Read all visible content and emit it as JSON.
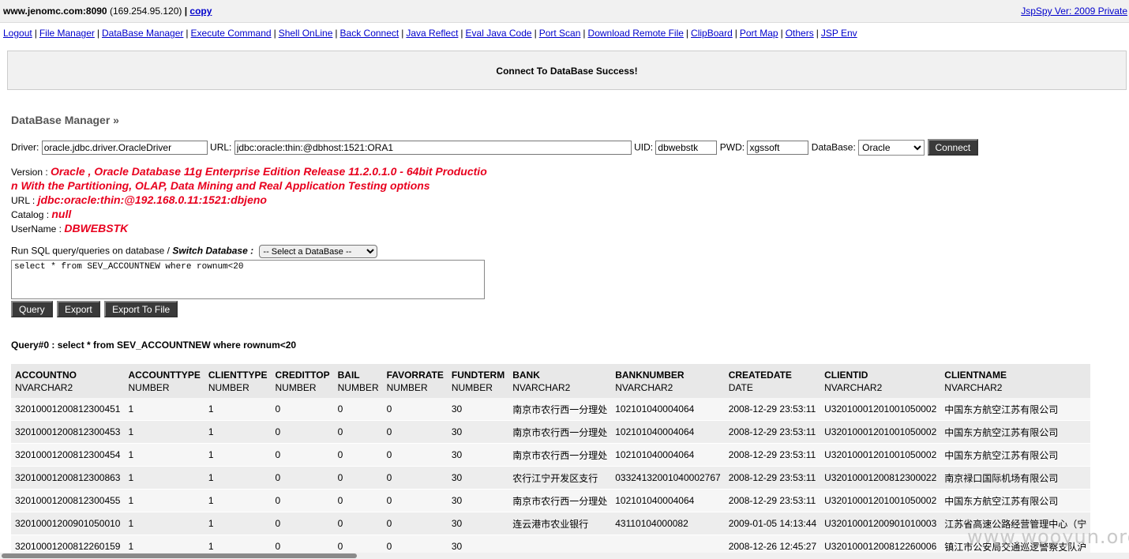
{
  "header": {
    "host": "www.jenomc.com:8090",
    "ip": "(169.254.95.120)",
    "sep": "|",
    "copy_label": "copy",
    "version_label": "JspSpy Ver: 2009 Private"
  },
  "nav": {
    "items": [
      "Logout",
      "File Manager",
      "DataBase Manager",
      "Execute Command",
      "Shell OnLine",
      "Back Connect",
      "Java Reflect",
      "Eval Java Code",
      "Port Scan",
      "Download Remote File",
      "ClipBoard",
      "Port Map",
      "Others",
      "JSP Env"
    ]
  },
  "message": "Connect To DataBase Success!",
  "db_manager_title": "DataBase Manager »",
  "connection": {
    "driver_label": "Driver:",
    "driver_value": "oracle.jdbc.driver.OracleDriver",
    "url_label": "URL:",
    "url_value": "jdbc:oracle:thin:@dbhost:1521:ORA1",
    "uid_label": "UID:",
    "uid_value": "dbwebstk",
    "pwd_label": "PWD:",
    "pwd_value": "xgssoft",
    "database_label": "DataBase:",
    "database_value": "Oracle",
    "connect_label": "Connect"
  },
  "info": {
    "version_label": "Version :",
    "version_value_1": "Oracle , Oracle Database 11g Enterprise Edition Release 11.2.0.1.0 - 64bit Productio",
    "version_value_2": "n With the Partitioning, OLAP, Data Mining and Real Application Testing options",
    "url_label": "URL :",
    "url_value": "jdbc:oracle:thin:@192.168.0.11:1521:dbjeno",
    "catalog_label": "Catalog :",
    "catalog_value": "null",
    "username_label": "UserName :",
    "username_value": "DBWEBSTK"
  },
  "sql": {
    "run_label": "Run SQL query/queries on database /",
    "switch_label": "Switch Database :",
    "switch_select_value": "-- Select a DataBase --",
    "query_text": "select * from SEV_ACCOUNTNEW where rownum<20",
    "query_button": "Query",
    "export_button": "Export",
    "export_file_button": "Export To File"
  },
  "result": {
    "title": "Query#0 : select * from SEV_ACCOUNTNEW where rownum<20",
    "columns": [
      {
        "name": "ACCOUNTNO",
        "type": "NVARCHAR2"
      },
      {
        "name": "ACCOUNTTYPE",
        "type": "NUMBER"
      },
      {
        "name": "CLIENTTYPE",
        "type": "NUMBER"
      },
      {
        "name": "CREDITTOP",
        "type": "NUMBER"
      },
      {
        "name": "BAIL",
        "type": "NUMBER"
      },
      {
        "name": "FAVORRATE",
        "type": "NUMBER"
      },
      {
        "name": "FUNDTERM",
        "type": "NUMBER"
      },
      {
        "name": "BANK",
        "type": "NVARCHAR2"
      },
      {
        "name": "BANKNUMBER",
        "type": "NVARCHAR2"
      },
      {
        "name": "CREATEDATE",
        "type": "DATE"
      },
      {
        "name": "CLIENTID",
        "type": "NVARCHAR2"
      },
      {
        "name": "CLIENTNAME",
        "type": "NVARCHAR2"
      }
    ],
    "rows": [
      [
        "3201000120081230045​1",
        "1",
        "1",
        "0",
        "0",
        "0",
        "30",
        "南京市农行西一分理处",
        "102101040004064",
        "2008-12-29 23:53:11",
        "U32010001201001050002",
        "中国东方航空江苏有限公司"
      ],
      [
        "32010001200812300453",
        "1",
        "1",
        "0",
        "0",
        "0",
        "30",
        "南京市农行西一分理处",
        "102101040004064",
        "2008-12-29 23:53:11",
        "U32010001201001050002",
        "中国东方航空江苏有限公司"
      ],
      [
        "32010001200812300454",
        "1",
        "1",
        "0",
        "0",
        "0",
        "30",
        "南京市农行西一分理处",
        "102101040004064",
        "2008-12-29 23:53:11",
        "U32010001201001050002",
        "中国东方航空江苏有限公司"
      ],
      [
        "32010001200812300863",
        "1",
        "1",
        "0",
        "0",
        "0",
        "30",
        "农行江宁开发区支行",
        "03324132001040002767",
        "2008-12-29 23:53:11",
        "U32010001200812300022",
        "南京禄口国际机场有限公司"
      ],
      [
        "32010001200812300455",
        "1",
        "1",
        "0",
        "0",
        "0",
        "30",
        "南京市农行西一分理处",
        "102101040004064",
        "2008-12-29 23:53:11",
        "U32010001201001050002",
        "中国东方航空江苏有限公司"
      ],
      [
        "32010001200901050010",
        "1",
        "1",
        "0",
        "0",
        "0",
        "30",
        "连云港市农业银行",
        "43110104000082",
        "2009-01-05 14:13:44",
        "U32010001200901010003",
        "江苏省高速公路经营管理中心（宁"
      ],
      [
        "32010001200812260159",
        "1",
        "1",
        "0",
        "0",
        "0",
        "30",
        "",
        "",
        "2008-12-26 12:45:27",
        "U32010001200812260006",
        "镇江市公安局交通巡逻警察支队沪"
      ]
    ]
  },
  "watermark": "www.wooyun.org"
}
